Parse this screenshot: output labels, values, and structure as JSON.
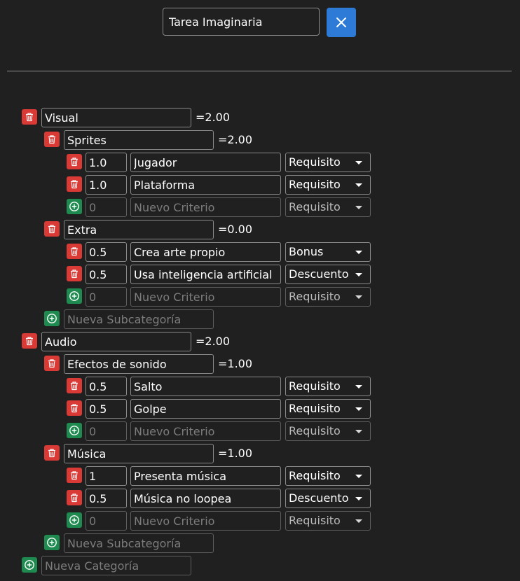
{
  "header": {
    "task_title": "Tarea Imaginaria",
    "close_glyph": "✕"
  },
  "placeholders": {
    "criterion": "Nuevo Criterio",
    "criterion_weight": "0",
    "subcategory": "Nueva Subcategoría",
    "category": "Nueva Categoría"
  },
  "new_criterion_type": "Requisito",
  "colors": {
    "accent": "#2d7bd6",
    "delete": "#d93a36",
    "add": "#1f8a50",
    "background": "#202020"
  },
  "categories": [
    {
      "name": "Visual",
      "total": "=2.00",
      "subcategories": [
        {
          "name": "Sprites",
          "total": "=2.00",
          "criteria": [
            {
              "weight": "1.0",
              "name": "Jugador",
              "type": "Requisito"
            },
            {
              "weight": "1.0",
              "name": "Plataforma",
              "type": "Requisito"
            }
          ]
        },
        {
          "name": "Extra",
          "total": "=0.00",
          "criteria": [
            {
              "weight": "0.5",
              "name": "Crea arte propio",
              "type": "Bonus"
            },
            {
              "weight": "0.5",
              "name": "Usa inteligencia artificial",
              "type": "Descuento"
            }
          ]
        }
      ]
    },
    {
      "name": "Audio",
      "total": "=2.00",
      "subcategories": [
        {
          "name": "Efectos de sonido",
          "total": "=1.00",
          "criteria": [
            {
              "weight": "0.5",
              "name": "Salto",
              "type": "Requisito"
            },
            {
              "weight": "0.5",
              "name": "Golpe",
              "type": "Requisito"
            }
          ]
        },
        {
          "name": "Música",
          "total": "=1.00",
          "criteria": [
            {
              "weight": "1",
              "name": "Presenta música",
              "type": "Requisito"
            },
            {
              "weight": "0.5",
              "name": "Música no loopea",
              "type": "Descuento"
            }
          ]
        }
      ]
    }
  ]
}
